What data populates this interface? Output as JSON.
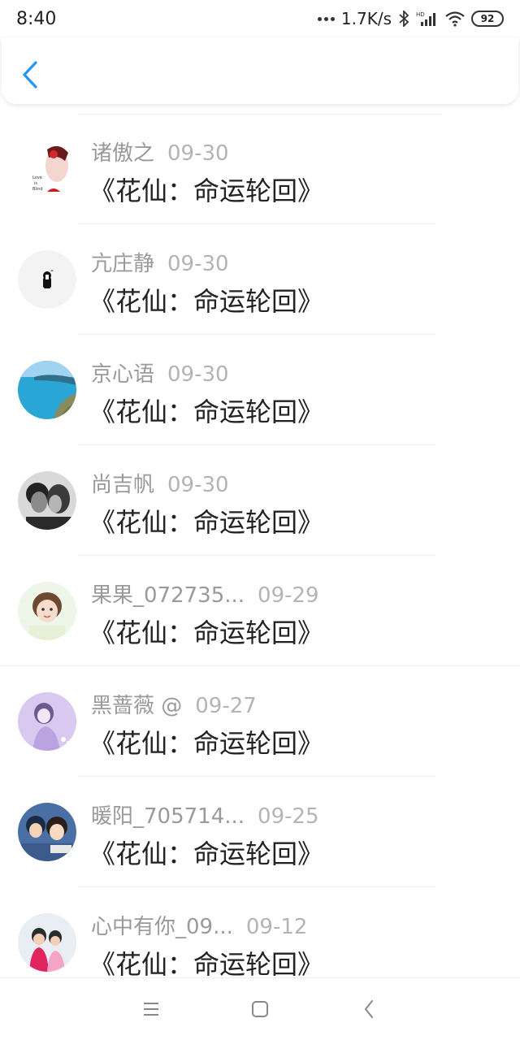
{
  "status_bar": {
    "time": "8:40",
    "network_speed": "1.7K/s",
    "battery": "92",
    "icons": [
      "more-dots-icon",
      "bluetooth-icon",
      "hd-signal-icon",
      "wifi-icon",
      "battery-icon"
    ]
  },
  "header": {
    "back_icon": "chevron-left-icon",
    "accent_color": "#2196f3"
  },
  "items": [
    {
      "name": "诸傲之",
      "date": "09-30",
      "title": "《花仙：命运轮回》"
    },
    {
      "name": "亢庄静",
      "date": "09-30",
      "title": "《花仙：命运轮回》"
    },
    {
      "name": "京心语",
      "date": "09-30",
      "title": "《花仙：命运轮回》"
    },
    {
      "name": "尚吉帆",
      "date": "09-30",
      "title": "《花仙：命运轮回》"
    },
    {
      "name": "果果_072735...",
      "date": "09-29",
      "title": "《花仙：命运轮回》"
    },
    {
      "name": "黑蔷薇 @",
      "date": "09-27",
      "title": "《花仙：命运轮回》"
    },
    {
      "name": "暖阳_705714...",
      "date": "09-25",
      "title": "《花仙：命运轮回》"
    },
    {
      "name": "心中有你_09...",
      "date": "09-12",
      "title": "《花仙：命运轮回》"
    }
  ],
  "nav_bar": {
    "icons": [
      "menu-icon",
      "home-icon",
      "back-icon"
    ]
  }
}
